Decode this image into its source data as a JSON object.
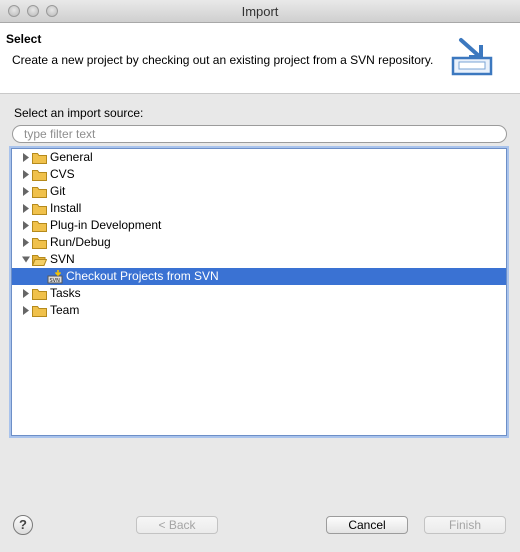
{
  "window": {
    "title": "Import"
  },
  "header": {
    "title": "Select",
    "description": "Create a new project by checking out an existing project from a SVN repository.",
    "icon": "import-wizard-icon"
  },
  "source_label": "Select an import source:",
  "filter": {
    "placeholder": "type filter text",
    "value": ""
  },
  "tree": {
    "items": [
      {
        "label": "General",
        "expanded": false
      },
      {
        "label": "CVS",
        "expanded": false
      },
      {
        "label": "Git",
        "expanded": false
      },
      {
        "label": "Install",
        "expanded": false
      },
      {
        "label": "Plug-in Development",
        "expanded": false
      },
      {
        "label": "Run/Debug",
        "expanded": false
      },
      {
        "label": "SVN",
        "expanded": true
      },
      {
        "label": "Checkout Projects from SVN",
        "selected": true,
        "icon": "svn-checkout-icon"
      },
      {
        "label": "Tasks",
        "expanded": false
      },
      {
        "label": "Team",
        "expanded": false
      }
    ]
  },
  "buttons": {
    "back": "< Back",
    "cancel": "Cancel",
    "finish": "Finish",
    "help": "?"
  },
  "colors": {
    "selection": "#3a72d3",
    "folder": "#f0c14b"
  }
}
